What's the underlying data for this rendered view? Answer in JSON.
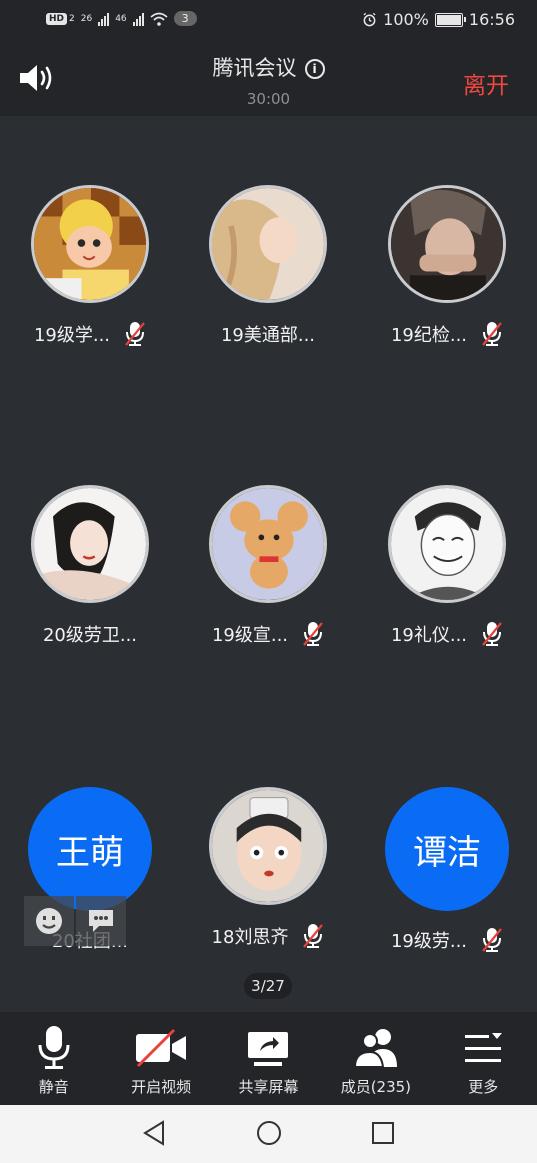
{
  "status_bar": {
    "hd": "HD",
    "hd_sub": "2",
    "net1": "26",
    "net2": "46",
    "notif_count": "3",
    "battery": "100%",
    "time": "16:56"
  },
  "header": {
    "title": "腾讯会议",
    "timer": "30:00",
    "leave_label": "离开"
  },
  "participants": [
    {
      "name": "19级学...",
      "muted": true
    },
    {
      "name": "19美通部...",
      "muted": false
    },
    {
      "name": "19纪检...",
      "muted": true
    },
    {
      "name": "20级劳卫...",
      "muted": false
    },
    {
      "name": "19级宣...",
      "muted": true
    },
    {
      "name": "19礼仪...",
      "muted": true
    },
    {
      "name": "20社团...",
      "muted": false,
      "avatar_text": "王萌"
    },
    {
      "name": "18刘思齐",
      "muted": true
    },
    {
      "name": "19级劳...",
      "muted": true,
      "avatar_text": "谭洁"
    }
  ],
  "page_indicator": "3/27",
  "toolbar": {
    "mute_label": "静音",
    "video_label": "开启视频",
    "share_label": "共享屏幕",
    "members_label": "成员(235)",
    "more_label": "更多"
  },
  "colors": {
    "accent_blue": "#0a6cf5",
    "leave_red": "#f1473f",
    "mute_red": "#e8413a"
  }
}
